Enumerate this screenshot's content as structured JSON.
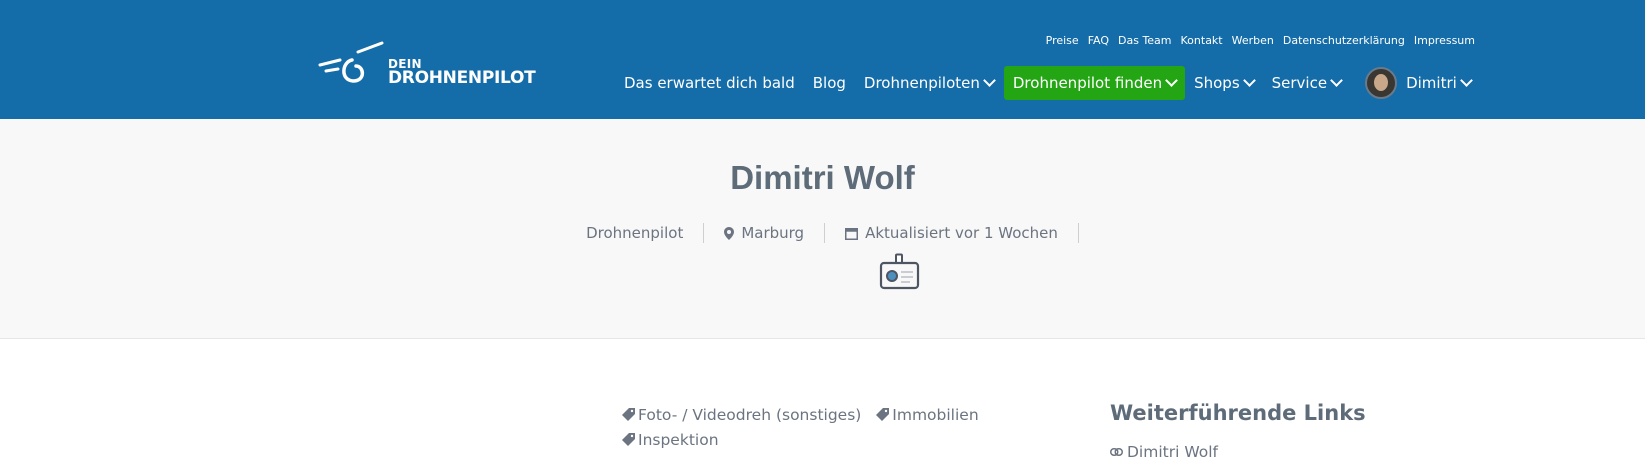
{
  "brand": {
    "line1": "DEIN",
    "line2": "DROHNENPILOT"
  },
  "toplinks": [
    "Preise",
    "FAQ",
    "Das Team",
    "Kontakt",
    "Werben",
    "Datenschutzerklärung",
    "Impressum"
  ],
  "nav": {
    "items": [
      {
        "label": "Das erwartet dich bald"
      },
      {
        "label": "Blog"
      },
      {
        "label": "Drohnenpiloten"
      },
      {
        "label": "Drohnenpilot finden"
      },
      {
        "label": "Shops"
      },
      {
        "label": "Service"
      }
    ],
    "user": "Dimitri"
  },
  "profile": {
    "name": "Dimitri Wolf",
    "role": "Drohnenpilot",
    "location": "Marburg",
    "updated": "Aktualisiert vor 1 Wochen"
  },
  "tags": [
    "Foto- / Videodreh (sonstiges)",
    "Immobilien",
    "Inspektion"
  ],
  "sidebar": {
    "title": "Weiterführende Links",
    "link": "Dimitri Wolf"
  },
  "colors": {
    "header": "#146ca8",
    "accent_green": "#24a514",
    "hero_bg": "#f8f8f8"
  }
}
